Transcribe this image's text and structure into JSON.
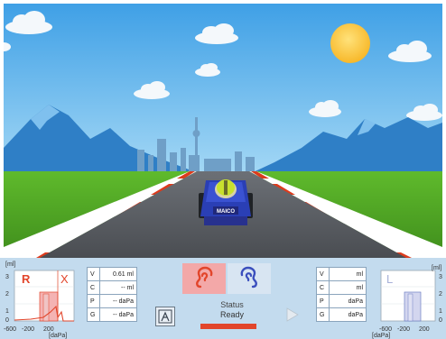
{
  "panel": {
    "left_tymp": {
      "unit_top": "[ml]",
      "y_ticks": [
        "3",
        "2",
        "1",
        "0"
      ],
      "x_ticks": [
        "-600",
        "-200",
        "200"
      ],
      "unit_bottom": "[daPa]",
      "ear_letter": "R",
      "mark": "X",
      "color": "#e2452b"
    },
    "right_tymp": {
      "unit_top": "[ml]",
      "y_ticks": [
        "3",
        "2",
        "1",
        "0"
      ],
      "x_ticks": [
        "-600",
        "-200",
        "200"
      ],
      "unit_bottom": "[daPa]",
      "ear_letter": "L",
      "color": "#6f7fc4"
    },
    "left_table": [
      {
        "key": "V",
        "value": "0.61 ml"
      },
      {
        "key": "C",
        "value": "-- ml"
      },
      {
        "key": "P",
        "value": "-- daPa"
      },
      {
        "key": "G",
        "value": "-- daPa"
      }
    ],
    "right_table": [
      {
        "key": "V",
        "value": "ml"
      },
      {
        "key": "C",
        "value": "ml"
      },
      {
        "key": "P",
        "value": "daPa"
      },
      {
        "key": "G",
        "value": "daPa"
      }
    ],
    "ear_buttons": {
      "right_ear": {
        "icon": "right-ear-icon",
        "selected": true,
        "color": "#e2452b"
      },
      "left_ear": {
        "icon": "left-ear-icon",
        "selected": false,
        "color": "#3b4fbd"
      }
    },
    "status": {
      "label": "Status",
      "value": "Ready",
      "bar_color": "#e2452b"
    },
    "buttons": {
      "test_icon": "stand-figure-icon",
      "play_icon": "play-icon"
    }
  },
  "scene": {
    "kart_brand": "MAICO",
    "sky_color": "#59b3ef",
    "grass_color": "#5cb42a",
    "road_color": "#52565c"
  }
}
